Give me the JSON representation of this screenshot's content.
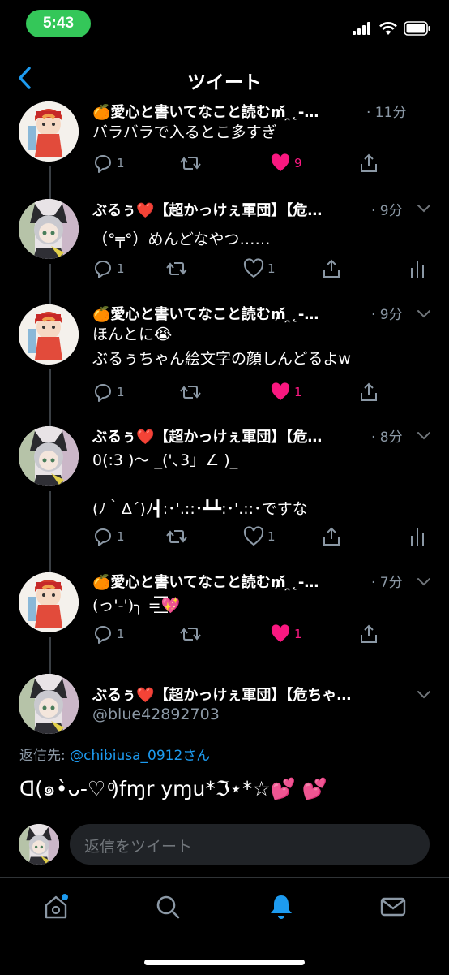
{
  "status_bar": {
    "time": "5:43"
  },
  "nav": {
    "title": "ツイート"
  },
  "tweets": [
    {
      "name": "🍊愛心と書いてなこと読む₥̆́ ̯˛-…",
      "time": "· 11分",
      "text": "バラバラで入るとこ多すぎ",
      "reply_count": "1",
      "like_count": "9",
      "liked": true
    },
    {
      "name": "ぶるぅ❤️【超かっけぇ軍団】【危…",
      "time": "· 9分",
      "text": "（°╤°）めんどなやつ……",
      "reply_count": "1",
      "like_count": "1",
      "liked": false
    },
    {
      "name": "🍊愛心と書いてなこと読む₥̆́ ̯˛-…",
      "time": "· 9分",
      "text": "ほんとに😭\nぶるぅちゃん絵文字の顔しんどるよw",
      "reply_count": "1",
      "like_count": "1",
      "liked": true
    },
    {
      "name": "ぶるぅ❤️【超かっけぇ軍団】【危…",
      "time": "· 8分",
      "text": "0(:3 )〜 _('､3」∠ )_\n\n(ﾉ｀Δ´)ﾉ┫:･'.::･┻┻:･'.::･ですな",
      "reply_count": "1",
      "like_count": "1",
      "liked": false
    },
    {
      "name": "🍊愛心と書いてなこと読む₥̆́ ̯˛-…",
      "time": "· 7分",
      "text": "(っ'-')╮ =͟͟͞͞💖",
      "reply_count": "1",
      "like_count": "1",
      "liked": true
    }
  ],
  "focused": {
    "name": "ぶるぅ❤️【超かっけぇ軍団】【危ちゃ…",
    "handle": "@blue42892703",
    "reply_label": "返信先: ",
    "reply_target": "@chibiusa_0912さん",
    "text": "ᗡ(๑•̀ᴗ-♡ ͦ)fɱr yɱu*ℑ⋆*☆💕 💕"
  },
  "compose": {
    "placeholder": "返信をツイート"
  },
  "tabs": [
    "home-icon",
    "search-icon",
    "notifications-icon",
    "messages-icon"
  ],
  "colors": {
    "accent": "#1d9bf0",
    "like": "#f91880",
    "muted": "#8b98a5",
    "status_pill": "#34c759"
  }
}
